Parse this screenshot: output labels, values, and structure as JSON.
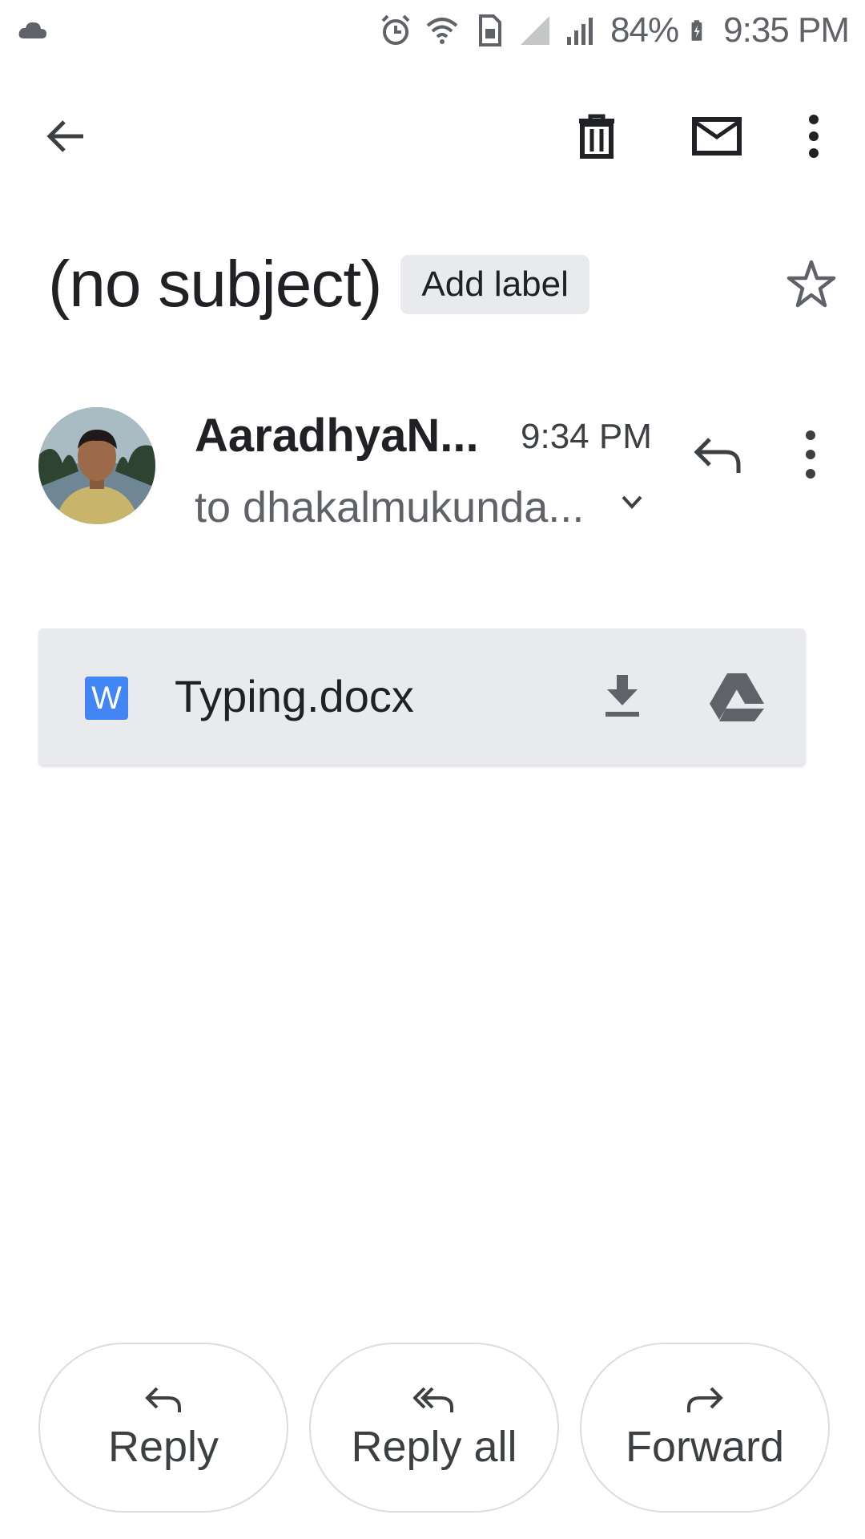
{
  "status_bar": {
    "battery": "84%",
    "time": "9:35 PM"
  },
  "app_bar": {
    "icons": [
      "back-arrow-icon",
      "trash-icon",
      "mail-icon",
      "more-vert-icon"
    ]
  },
  "message": {
    "subject": "(no subject)",
    "label_chip": "Add label",
    "sender": "AaradhyaN...",
    "time": "9:34 PM",
    "recipient": "to dhakalmukunda..."
  },
  "attachment": {
    "type_letter": "W",
    "filename": "Typing.docx"
  },
  "actions": {
    "reply": "Reply",
    "reply_all": "Reply all",
    "forward": "Forward"
  },
  "colors": {
    "word_blue": "#4285f4",
    "chip_bg": "#e8eaed",
    "icon_gray": "#5f6368"
  }
}
